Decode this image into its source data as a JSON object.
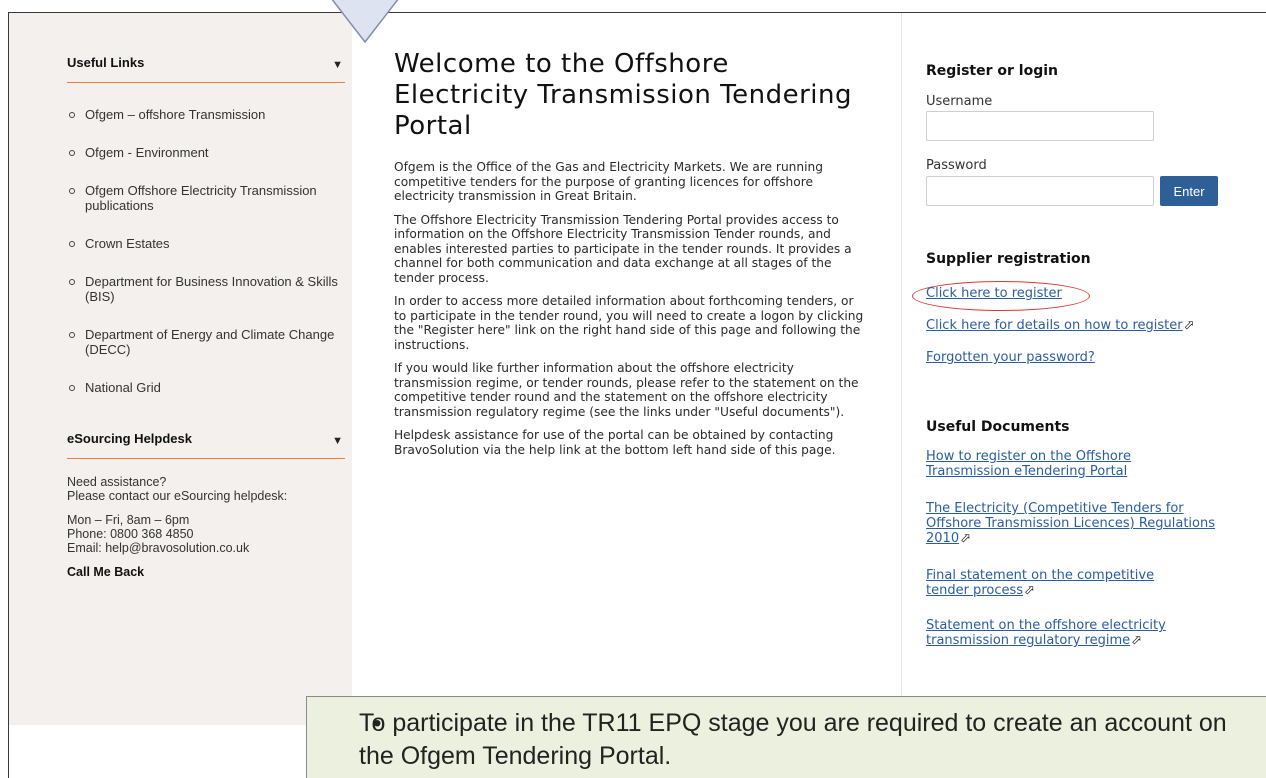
{
  "sidebar": {
    "useful_links_heading": "Useful Links",
    "links": [
      "Ofgem – offshore Transmission",
      "Ofgem - Environment",
      "Ofgem Offshore Electricity Transmission publications",
      "Crown Estates",
      "Department for Business Innovation & Skills (BIS)",
      "Department of Energy and Climate Change (DECC)",
      "National Grid"
    ],
    "helpdesk_heading": "eSourcing Helpdesk",
    "help_assist": "Need assistance?",
    "help_contact": "Please contact our eSourcing helpdesk:",
    "hours": "Mon – Fri, 8am – 6pm",
    "phone": "Phone: 0800 368 4850",
    "email": "Email: help@bravosolution.co.uk",
    "call_me_back": "Call Me Back"
  },
  "main": {
    "title": "Welcome to the Offshore Electricity Transmission Tendering Portal",
    "paragraphs": [
      "Ofgem is the Office of the Gas and Electricity Markets. We are running competitive tenders for the purpose of granting licences for offshore electricity transmission in Great Britain.",
      "The Offshore Electricity Transmission Tendering Portal provides access to information on the Offshore Electricity Transmission Tender rounds, and enables interested parties to participate in the tender rounds. It provides a channel for both communication and data exchange at all stages of the tender process.",
      "In order to access more detailed information about forthcoming tenders, or to participate in the tender round, you will need to create a logon by clicking the \"Register here\" link on the right hand side of this page and following the instructions.",
      "If you would like further information about the offshore electricity transmission regime, or tender rounds, please refer to the statement on the competitive tender round and the statement on the offshore electricity transmission regulatory regime (see the links under \"Useful documents\").",
      "Helpdesk assistance for use of the portal can be obtained by contacting BravoSolution via the help link at the bottom left hand side of this page."
    ]
  },
  "login": {
    "heading": "Register or login",
    "username_label": "Username",
    "username_value": "",
    "password_label": "Password",
    "password_value": "",
    "enter_label": "Enter"
  },
  "supplier": {
    "heading": "Supplier registration",
    "register_link": "Click here to register",
    "details_link": "Click here for details on how to register",
    "forgot_link": "Forgotten your password?"
  },
  "documents": {
    "heading": "Useful Documents",
    "items": [
      "How to register on the Offshore Transmission eTendering Portal",
      "The Electricity (Competitive Tenders for Offshore Transmission Licences) Regulations 2010",
      "Final statement on the competitive tender process",
      "Statement on the offshore electricity transmission regulatory regime"
    ]
  },
  "callout": {
    "text": "To participate in the TR11 EPQ stage you are required to create an account on the Ofgem Tendering Portal."
  },
  "colors": {
    "accent_line": "#e8803a",
    "link": "#2a5d9f",
    "button": "#2f5f97",
    "callout_bg": "#ebf1de",
    "highlight_ring": "#d43a3a"
  },
  "icons": {
    "dropdown": "caret-down-icon",
    "external": "external-link-arrow-icon",
    "bullet": "hollow-circle-bullet"
  }
}
